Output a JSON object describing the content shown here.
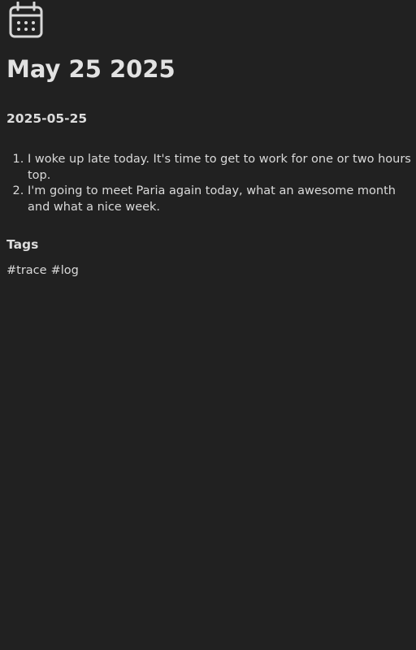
{
  "header": {
    "icon": "calendar-icon",
    "title": "May 25 2025"
  },
  "entry": {
    "date": "2025-05-25",
    "items": [
      "I woke up late today. It's time to get to work for one or two hours top.",
      "I'm going to meet Paria again today, what an awesome month and what a nice week."
    ]
  },
  "tags": {
    "heading": "Tags",
    "items": [
      "#trace",
      "#log"
    ]
  },
  "colors": {
    "background": "#212121",
    "text": "#dadada"
  }
}
